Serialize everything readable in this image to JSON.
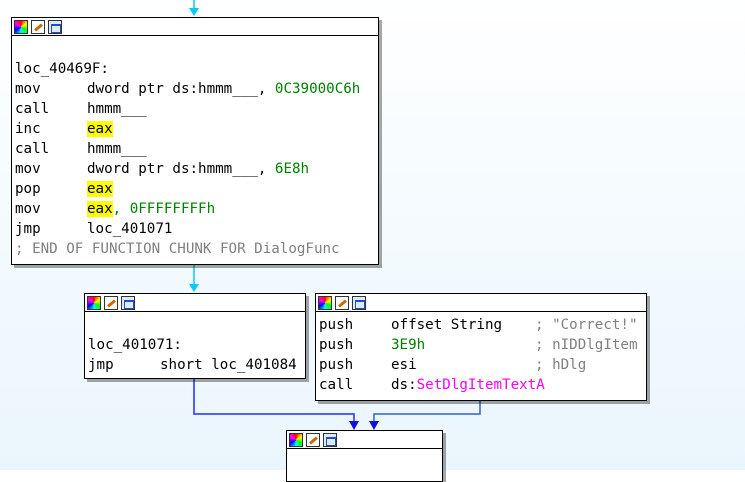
{
  "blocks": {
    "top": {
      "lines": [
        {
          "mn": "",
          "op1": "",
          "op1_cls": "",
          "rest": ""
        },
        {
          "mn": "loc_40469F:",
          "op1": "",
          "op1_cls": "",
          "rest": ""
        },
        {
          "mn": "mov",
          "op1": "dword ptr ds:hmmm___, ",
          "op1_cls": "",
          "rest": "0C39000C6h",
          "rest_cls": "num"
        },
        {
          "mn": "call",
          "op1": "hmmm___",
          "op1_cls": "",
          "rest": ""
        },
        {
          "mn": "inc",
          "op1": "eax",
          "op1_cls": "hl",
          "rest": ""
        },
        {
          "mn": "call",
          "op1": "hmmm___",
          "op1_cls": "",
          "rest": ""
        },
        {
          "mn": "mov",
          "op1": "dword ptr ds:hmmm___, ",
          "op1_cls": "",
          "rest": "6E8h",
          "rest_cls": "num"
        },
        {
          "mn": "pop",
          "op1": "eax",
          "op1_cls": "hl",
          "rest": ""
        },
        {
          "mn": "mov",
          "op1": "eax",
          "op1_cls": "hl",
          "rest": ", 0FFFFFFFFh",
          "rest_cls": "num"
        },
        {
          "mn": "jmp",
          "op1": "loc_401071",
          "op1_cls": "",
          "rest": ""
        },
        {
          "mn": "; END OF FUNCTION CHUNK FOR DialogFunc",
          "mn_cls": "cmt",
          "op1": "",
          "op1_cls": "",
          "rest": ""
        }
      ]
    },
    "left": {
      "lines": [
        {
          "mn": "",
          "op1": "",
          "rest": ""
        },
        {
          "mn": "loc_401071:",
          "op1": "",
          "rest": ""
        },
        {
          "mn": "jmp",
          "op1": "short loc_401084",
          "rest": ""
        }
      ]
    },
    "right": {
      "lines": [
        {
          "mn": "push",
          "op1": "offset String",
          "cmt": "; \"Correct!\""
        },
        {
          "mn": "push",
          "op1": "3E9h",
          "op1_cls": "num",
          "cmt": "; nIDDlgItem"
        },
        {
          "mn": "push",
          "op1": "esi",
          "cmt": "; hDlg"
        },
        {
          "mn": "call",
          "op1": "ds:",
          "api": "SetDlgItemTextA"
        }
      ]
    }
  },
  "colors": {
    "edge_cyan": "#00ccff",
    "edge_blue": "#2030ff",
    "edge_gray_blue": "#3060d0"
  },
  "icons": [
    "color-palette-icon",
    "edit-icon",
    "graph-icon"
  ]
}
